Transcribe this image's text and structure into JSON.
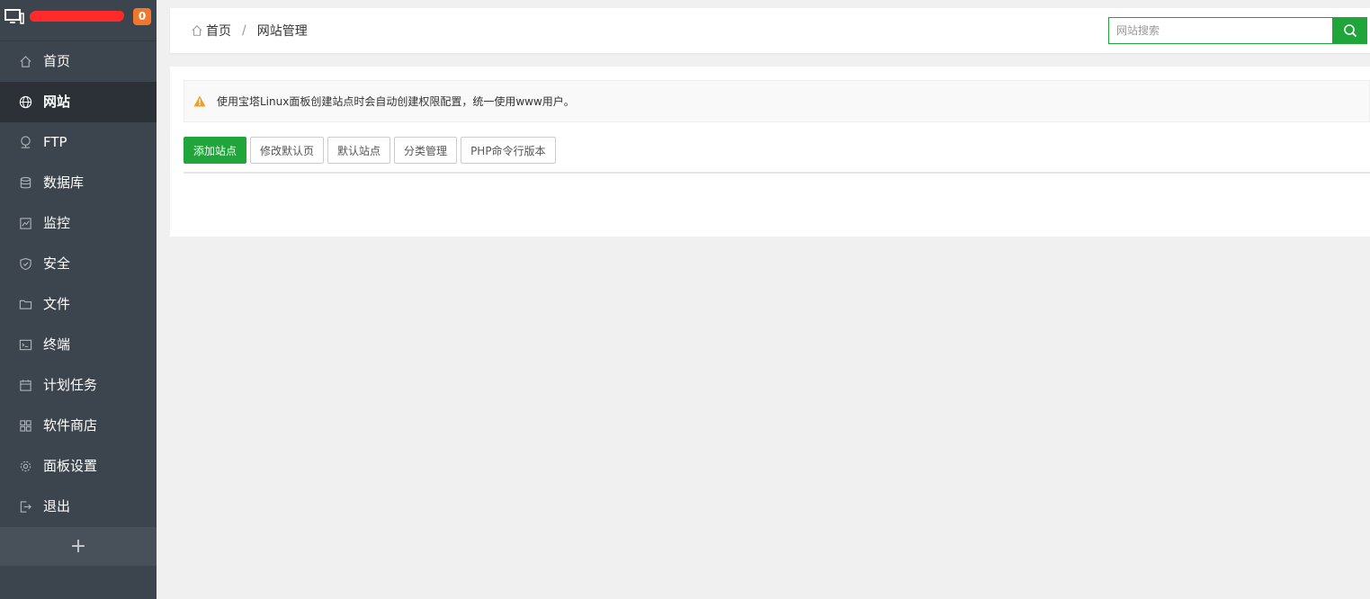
{
  "sidebar": {
    "badge": "0",
    "items": [
      {
        "label": "首页",
        "icon": "home-icon",
        "active": false
      },
      {
        "label": "网站",
        "icon": "globe-icon",
        "active": true
      },
      {
        "label": "FTP",
        "icon": "ftp-icon",
        "active": false
      },
      {
        "label": "数据库",
        "icon": "database-icon",
        "active": false
      },
      {
        "label": "监控",
        "icon": "monitor-chart-icon",
        "active": false
      },
      {
        "label": "安全",
        "icon": "shield-icon",
        "active": false
      },
      {
        "label": "文件",
        "icon": "folder-icon",
        "active": false
      },
      {
        "label": "终端",
        "icon": "terminal-icon",
        "active": false
      },
      {
        "label": "计划任务",
        "icon": "calendar-icon",
        "active": false
      },
      {
        "label": "软件商店",
        "icon": "grid-icon",
        "active": false
      },
      {
        "label": "面板设置",
        "icon": "gear-icon",
        "active": false
      },
      {
        "label": "退出",
        "icon": "logout-icon",
        "active": false
      }
    ],
    "add_label": "+"
  },
  "breadcrumb": {
    "home": "首页",
    "separator": "/",
    "current": "网站管理"
  },
  "search": {
    "placeholder": "网站搜索"
  },
  "notice": {
    "text": "使用宝塔Linux面板创建站点时会自动创建权限配置，统一使用www用户。"
  },
  "toolbar": {
    "add_site": "添加站点",
    "edit_default_page": "修改默认页",
    "default_site": "默认站点",
    "category_manage": "分类管理",
    "php_cli_version": "PHP命令行版本"
  },
  "colors": {
    "accent": "#20a53a",
    "sidebar_bg": "#3c444d",
    "sidebar_active": "#2c3138",
    "badge": "#f0772d",
    "warning": "#f0a020"
  }
}
